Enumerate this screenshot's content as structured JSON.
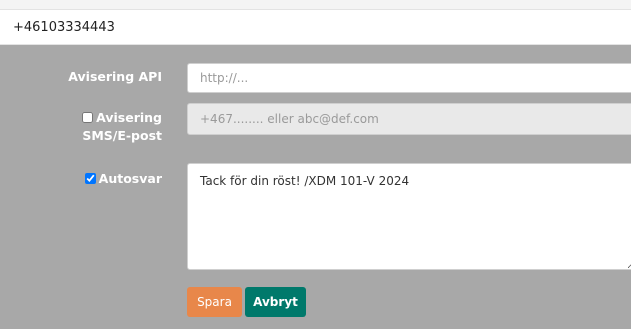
{
  "header": {
    "phone_number": "+46103334443"
  },
  "form": {
    "api": {
      "label": "Avisering API",
      "placeholder": "http://..."
    },
    "sms": {
      "label": "Avisering SMS/E-post",
      "checked": false,
      "placeholder": "+467........ eller abc@def.com"
    },
    "autoreply": {
      "label": "Autosvar",
      "checked": true,
      "value": "Tack för din röst! /XDM 101-V 2024"
    }
  },
  "actions": {
    "save_label": "Spara",
    "cancel_label": "Avbryt"
  },
  "colors": {
    "panel_bg": "#a8a8a8",
    "save_button": "#e8874a",
    "cancel_button": "#00796b"
  }
}
